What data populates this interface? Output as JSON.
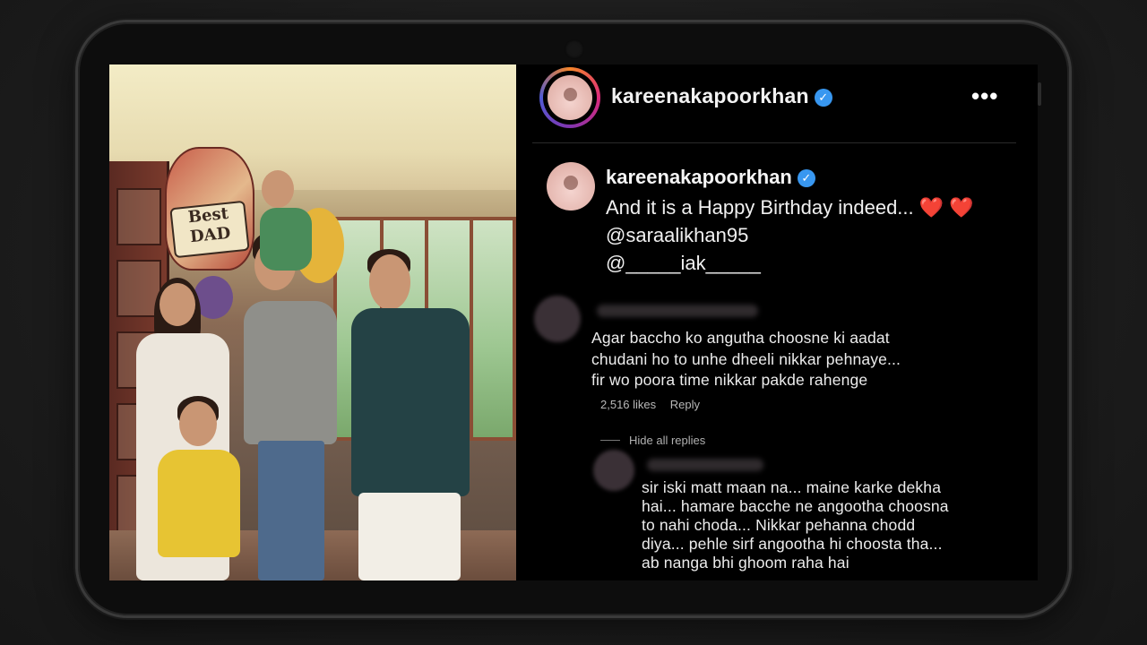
{
  "post": {
    "username": "kareenakapoorkhan",
    "verified_badge": "✓",
    "more_icon": "•••",
    "photo_balloon_text": "Best DAD"
  },
  "caption": {
    "username": "kareenakapoorkhan",
    "text": "And it is a Happy Birthday indeed...",
    "hearts": "❤️ ❤️",
    "mention1": "@saraalikhan95",
    "mention2": "@_____iak_____"
  },
  "comments": [
    {
      "text_lines": [
        "Agar baccho ko angutha choosne ki aadat",
        "chudani ho to unhe dheeli nikkar pehnaye...",
        "fir wo poora time nikkar pakde rahenge"
      ],
      "likes": "2,516 likes",
      "reply_label": "Reply",
      "toggle_replies": "Hide all replies",
      "replies": [
        {
          "text_lines": [
            "sir iski matt maan na... maine karke dekha",
            "hai... hamare bacche ne angootha choosna",
            "to nahi choda... Nikkar pehanna chodd",
            "diya... pehle sirf angootha hi choosta tha...",
            "ab nanga bhi ghoom raha hai"
          ]
        }
      ]
    }
  ],
  "colors": {
    "background": "#1c1c1c",
    "screen": "#000000",
    "verified": "#3897f0",
    "heart": "#e02a2a",
    "text": "#f5f5f5",
    "muted": "#b8b8b8"
  }
}
